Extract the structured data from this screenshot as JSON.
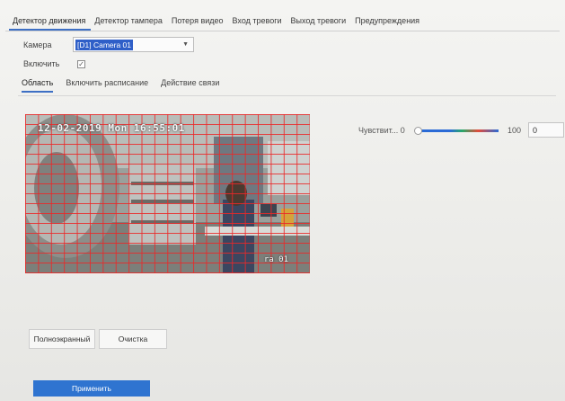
{
  "tabs": [
    {
      "label": "Детектор движения",
      "active": true
    },
    {
      "label": "Детектор тампера",
      "active": false
    },
    {
      "label": "Потеря видео",
      "active": false
    },
    {
      "label": "Вход тревоги",
      "active": false
    },
    {
      "label": "Выход тревоги",
      "active": false
    },
    {
      "label": "Предупреждения",
      "active": false
    }
  ],
  "camera": {
    "label": "Камера",
    "value": "[D1] Camera 01"
  },
  "enable": {
    "label": "Включить",
    "checked": true
  },
  "subtabs": [
    {
      "label": "Область",
      "active": true
    },
    {
      "label": "Включить расписание",
      "active": false
    },
    {
      "label": "Действие связи",
      "active": false
    }
  ],
  "video": {
    "osd_time": "12-02-2019 Mon 16:55:01",
    "osd_name": "ra 01"
  },
  "sensitivity": {
    "label": "Чувствит...",
    "min": "0",
    "max": "100",
    "value": "0",
    "level": 0
  },
  "buttons": {
    "fullscreen": "Полноэкранный",
    "clear": "Очистка",
    "apply": "Применить"
  },
  "colors": {
    "accent": "#2f74d0",
    "grid": "#eb2828"
  }
}
